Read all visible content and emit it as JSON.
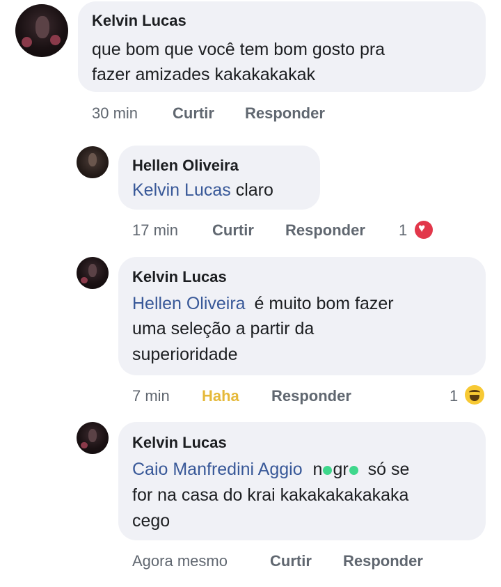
{
  "comments": [
    {
      "author": "Kelvin Lucas",
      "text_lines": [
        "que bom que você tem bom gosto pra",
        "fazer amizades kakakakakak"
      ],
      "time": "30 min",
      "like_label": "Curtir",
      "reply_label": "Responder"
    },
    {
      "author": "Hellen Oliveira",
      "mention": "Kelvin Lucas",
      "text": "claro",
      "time": "17 min",
      "like_label": "Curtir",
      "reply_label": "Responder",
      "reaction_count": "1",
      "reaction_icon": "heart-icon",
      "reaction_color": "#e2374a"
    },
    {
      "author": "Kelvin Lucas",
      "mention": "Hellen Oliveira",
      "text_first": "é muito bom fazer",
      "text_lines": [
        "uma seleção a partir da",
        "superioridade"
      ],
      "time": "7 min",
      "like_label": "Haha",
      "like_color": "#e5b93a",
      "reply_label": "Responder",
      "reaction_count": "1",
      "reaction_icon": "haha-icon"
    },
    {
      "author": "Kelvin Lucas",
      "mention": "Caio Manfredini Aggio",
      "censored_a": "n",
      "censored_b": "gr",
      "text_after": "só se",
      "text_lines": [
        "for na casa do krai kakakakakakaka",
        "cego"
      ],
      "time": "Agora mesmo",
      "like_label": "Curtir",
      "reply_label": "Responder"
    }
  ],
  "colors": {
    "bubble": "#f0f1f6",
    "mention": "#385898",
    "meta": "#606770",
    "censor_dot": "#3fd78c"
  }
}
